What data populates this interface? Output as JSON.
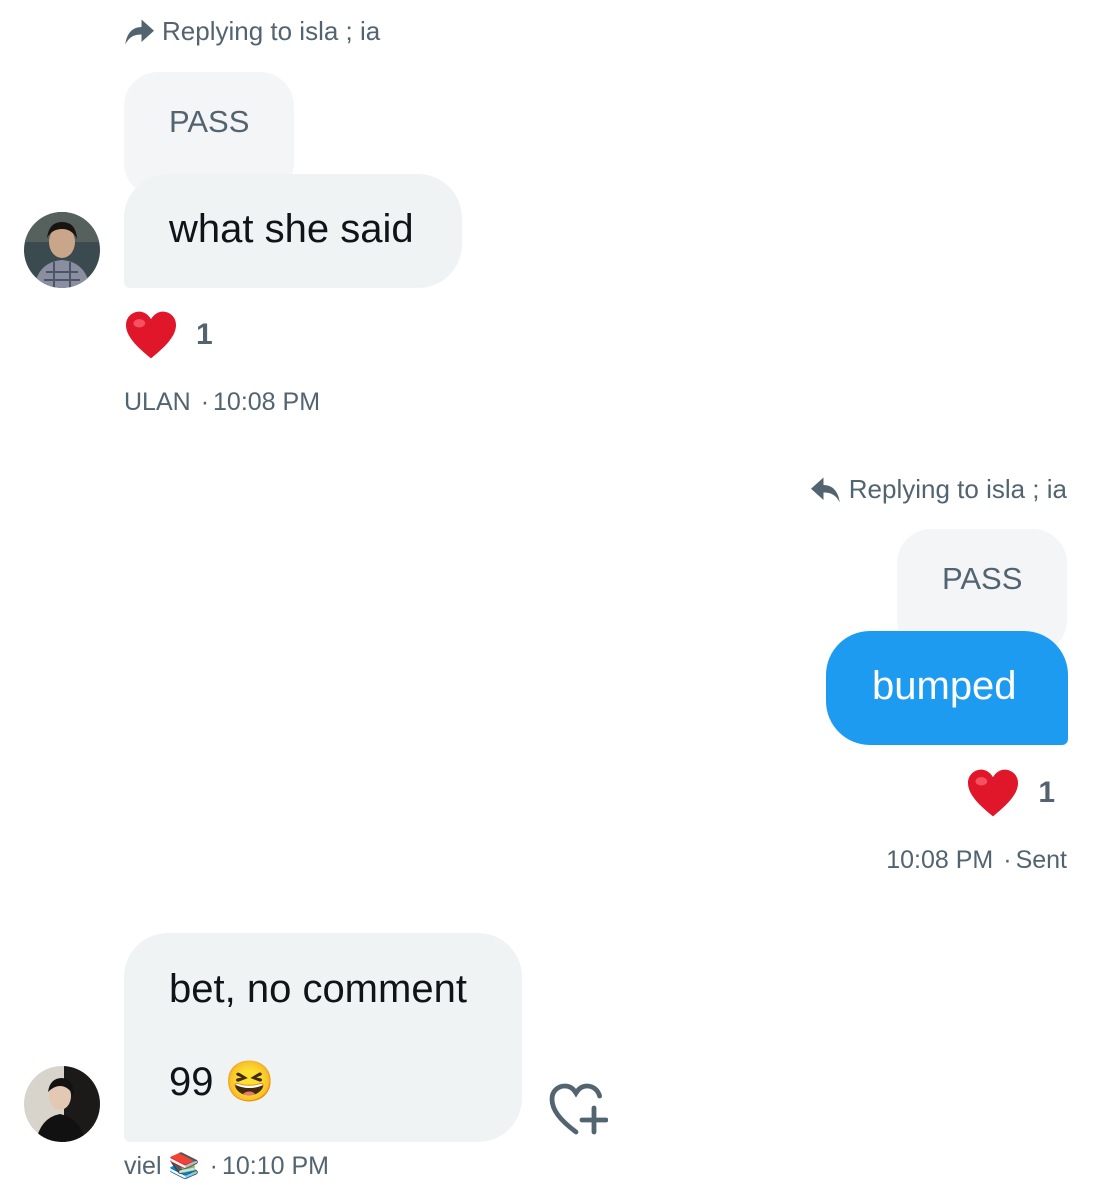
{
  "conversation": {
    "messages": [
      {
        "direction": "incoming",
        "reply_label": "Replying to isla ; ia",
        "quoted_text": "PASS",
        "text": "what she said",
        "reaction": {
          "emoji": "❤️",
          "count": "1"
        },
        "sender": "ULAN",
        "time": "10:08 PM"
      },
      {
        "direction": "outgoing",
        "reply_label": "Replying to isla ; ia",
        "quoted_text": "PASS",
        "text": "bumped",
        "reaction": {
          "emoji": "❤️",
          "count": "1"
        },
        "time": "10:08 PM",
        "status": "Sent"
      },
      {
        "direction": "incoming",
        "text_line1": "bet, no comment",
        "text_line2": "99",
        "text_emoji": "😆",
        "sender": "viel",
        "sender_emoji": "📚",
        "time": "10:10 PM",
        "add_reaction_icon": "heart-plus-icon"
      }
    ]
  },
  "colors": {
    "accent": "#1d9bf0",
    "bubble_incoming": "#eff3f4",
    "secondary_text": "#536471",
    "heart": "#e0162b"
  }
}
